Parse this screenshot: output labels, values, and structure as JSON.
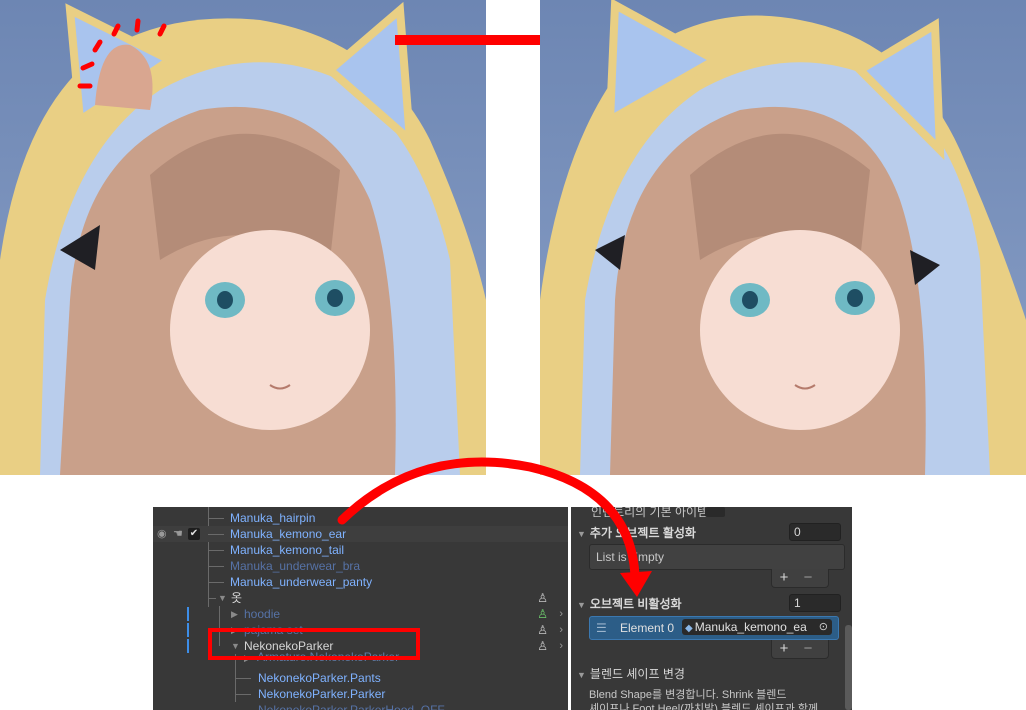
{
  "hierarchy": {
    "items": [
      {
        "label": "Manuka_hairpin"
      },
      {
        "label": "Manuka_kemono_ear"
      },
      {
        "label": "Manuka_kemono_tail"
      },
      {
        "label": "Manuka_underwear_bra"
      },
      {
        "label": "Manuka_underwear_panty"
      },
      {
        "label": "옷"
      },
      {
        "label": "hoodie"
      },
      {
        "label": "pajama set"
      },
      {
        "label": "NekonekoParker"
      },
      {
        "label": "Armature.NekonekoParker"
      },
      {
        "label": "NekonekoParker.Pants"
      },
      {
        "label": "NekonekoParker.Parker"
      },
      {
        "label": "NekonekoParker.ParkerHood_OFF"
      }
    ]
  },
  "inspector": {
    "cut_top_label": "인벤토리의 기본 아이템",
    "section_enable": {
      "title": "추가 오브젝트 활성화",
      "count": "0",
      "empty_label": "List is Empty"
    },
    "section_disable": {
      "title": "오브젝트 비활성화",
      "count": "1",
      "element_label": "Element 0",
      "element_value": "Manuka_kemono_ea"
    },
    "section_blend": {
      "title": "블렌드 셰이프 변경",
      "body_line1": "Blend Shape를 변경합니다. Shrink 블렌드",
      "body_line2": "셰이프나 Foot Heel(까치발) 블렌드 셰이프과 함께"
    },
    "plus": "+",
    "minus": "−"
  },
  "colors": {
    "annotation_red": "#ff0000",
    "hierarchy_bg": "#383838",
    "inspector_bg": "#383838",
    "prefab_blue": "#7fb2ff",
    "selection_blue": "#2c5d87"
  }
}
